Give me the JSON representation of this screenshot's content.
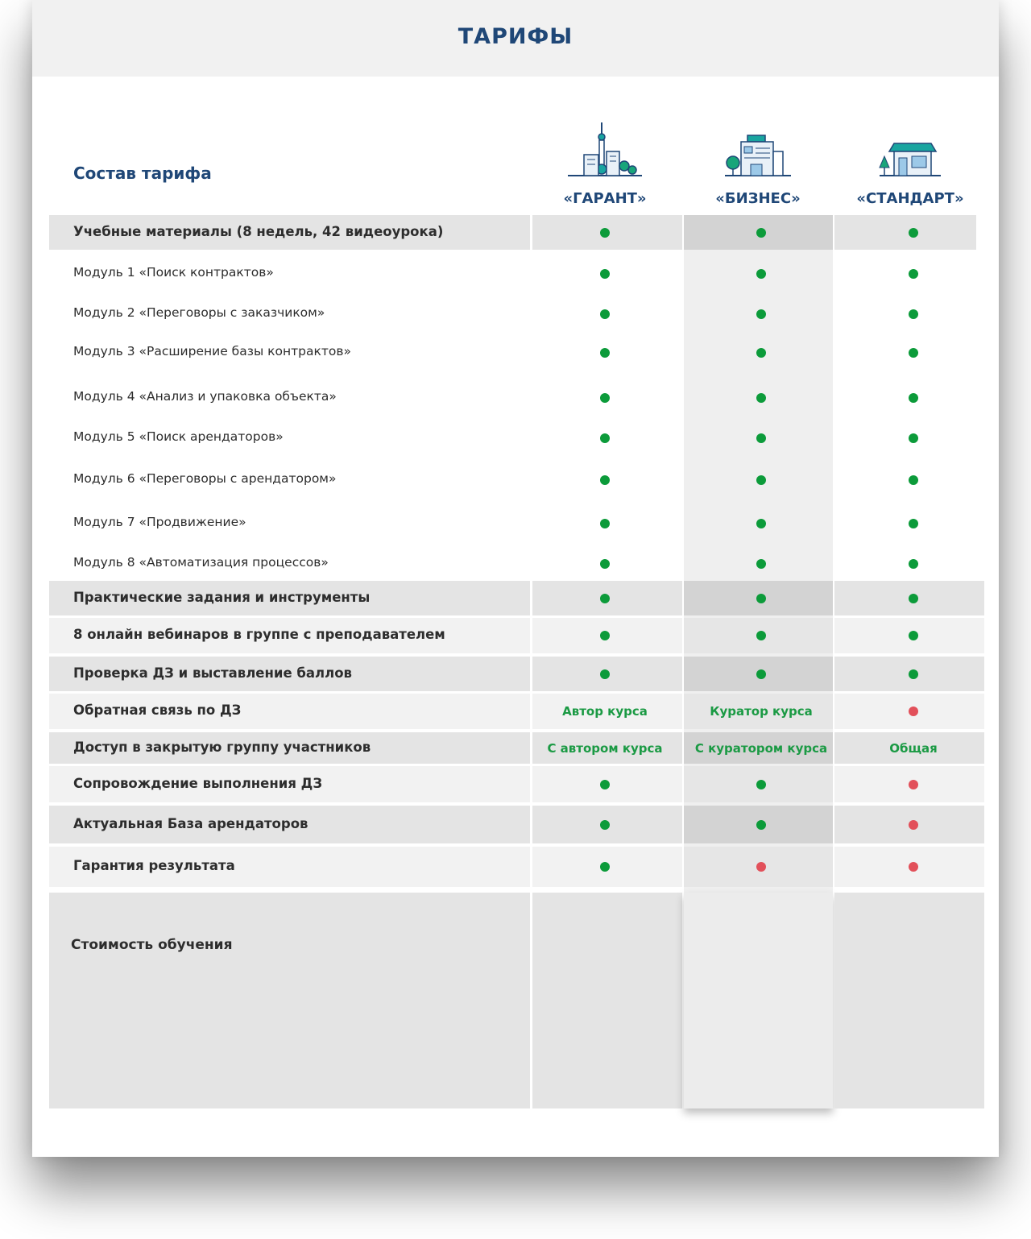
{
  "header": {
    "title": "ТАРИФЫ"
  },
  "table": {
    "subtitle": "Состав тарифа",
    "plans": [
      {
        "name": "«ГАРАНТ»",
        "icon": "city-tower-icon"
      },
      {
        "name": "«БИЗНЕС»",
        "icon": "office-building-icon"
      },
      {
        "name": "«СТАНДАРТ»",
        "icon": "shop-house-icon"
      }
    ],
    "rows": [
      {
        "label": "Учебные материалы (8 недель, 42 видеоурока)",
        "bold": true,
        "values": [
          "yes",
          "yes",
          "yes"
        ]
      },
      {
        "label": "Модуль 1 «Поиск контрактов»",
        "bold": false,
        "values": [
          "yes",
          "yes",
          "yes"
        ]
      },
      {
        "label": "Модуль 2 «Переговоры с заказчиком»",
        "bold": false,
        "values": [
          "yes",
          "yes",
          "yes"
        ]
      },
      {
        "label": "Модуль 3 «Расширение базы контрактов»",
        "bold": false,
        "values": [
          "yes",
          "yes",
          "yes"
        ]
      },
      {
        "label": "Модуль 4 «Анализ и упаковка объекта»",
        "bold": false,
        "values": [
          "yes",
          "yes",
          "yes"
        ]
      },
      {
        "label": "Модуль 5 «Поиск арендаторов»",
        "bold": false,
        "values": [
          "yes",
          "yes",
          "yes"
        ]
      },
      {
        "label": "Модуль 6 «Переговоры с арендатором»",
        "bold": false,
        "values": [
          "yes",
          "yes",
          "yes"
        ]
      },
      {
        "label": "Модуль 7 «Продвижение»",
        "bold": false,
        "values": [
          "yes",
          "yes",
          "yes"
        ]
      },
      {
        "label": "Модуль 8 «Автоматизация процессов»",
        "bold": false,
        "values": [
          "yes",
          "yes",
          "yes"
        ]
      },
      {
        "label": "Практические задания и инструменты",
        "bold": true,
        "values": [
          "yes",
          "yes",
          "yes"
        ]
      },
      {
        "label": "8 онлайн вебинаров в группе с преподавателем",
        "bold": true,
        "values": [
          "yes",
          "yes",
          "yes"
        ]
      },
      {
        "label": "Проверка ДЗ и выставление баллов",
        "bold": true,
        "values": [
          "yes",
          "yes",
          "yes"
        ]
      },
      {
        "label": "Обратная связь по ДЗ",
        "bold": true,
        "values": [
          "Автор курса",
          "Куратор курса",
          "no"
        ]
      },
      {
        "label": "Доступ в закрытую группу участников",
        "bold": true,
        "values": [
          "С автором курса",
          "С куратором курса",
          "Общая"
        ]
      },
      {
        "label": "Сопровождение выполнения ДЗ",
        "bold": true,
        "values": [
          "yes",
          "yes",
          "no"
        ]
      },
      {
        "label": "Актуальная База арендаторов",
        "bold": true,
        "values": [
          "yes",
          "yes",
          "no"
        ]
      },
      {
        "label": "Гарантия результата",
        "bold": true,
        "values": [
          "yes",
          "no",
          "no"
        ]
      }
    ],
    "price_label": "Стоимость обучения"
  },
  "colors": {
    "title": "#1f4777",
    "yes": "#0c9b3a",
    "no": "#e2505a",
    "value_text": "#1b9a44"
  }
}
